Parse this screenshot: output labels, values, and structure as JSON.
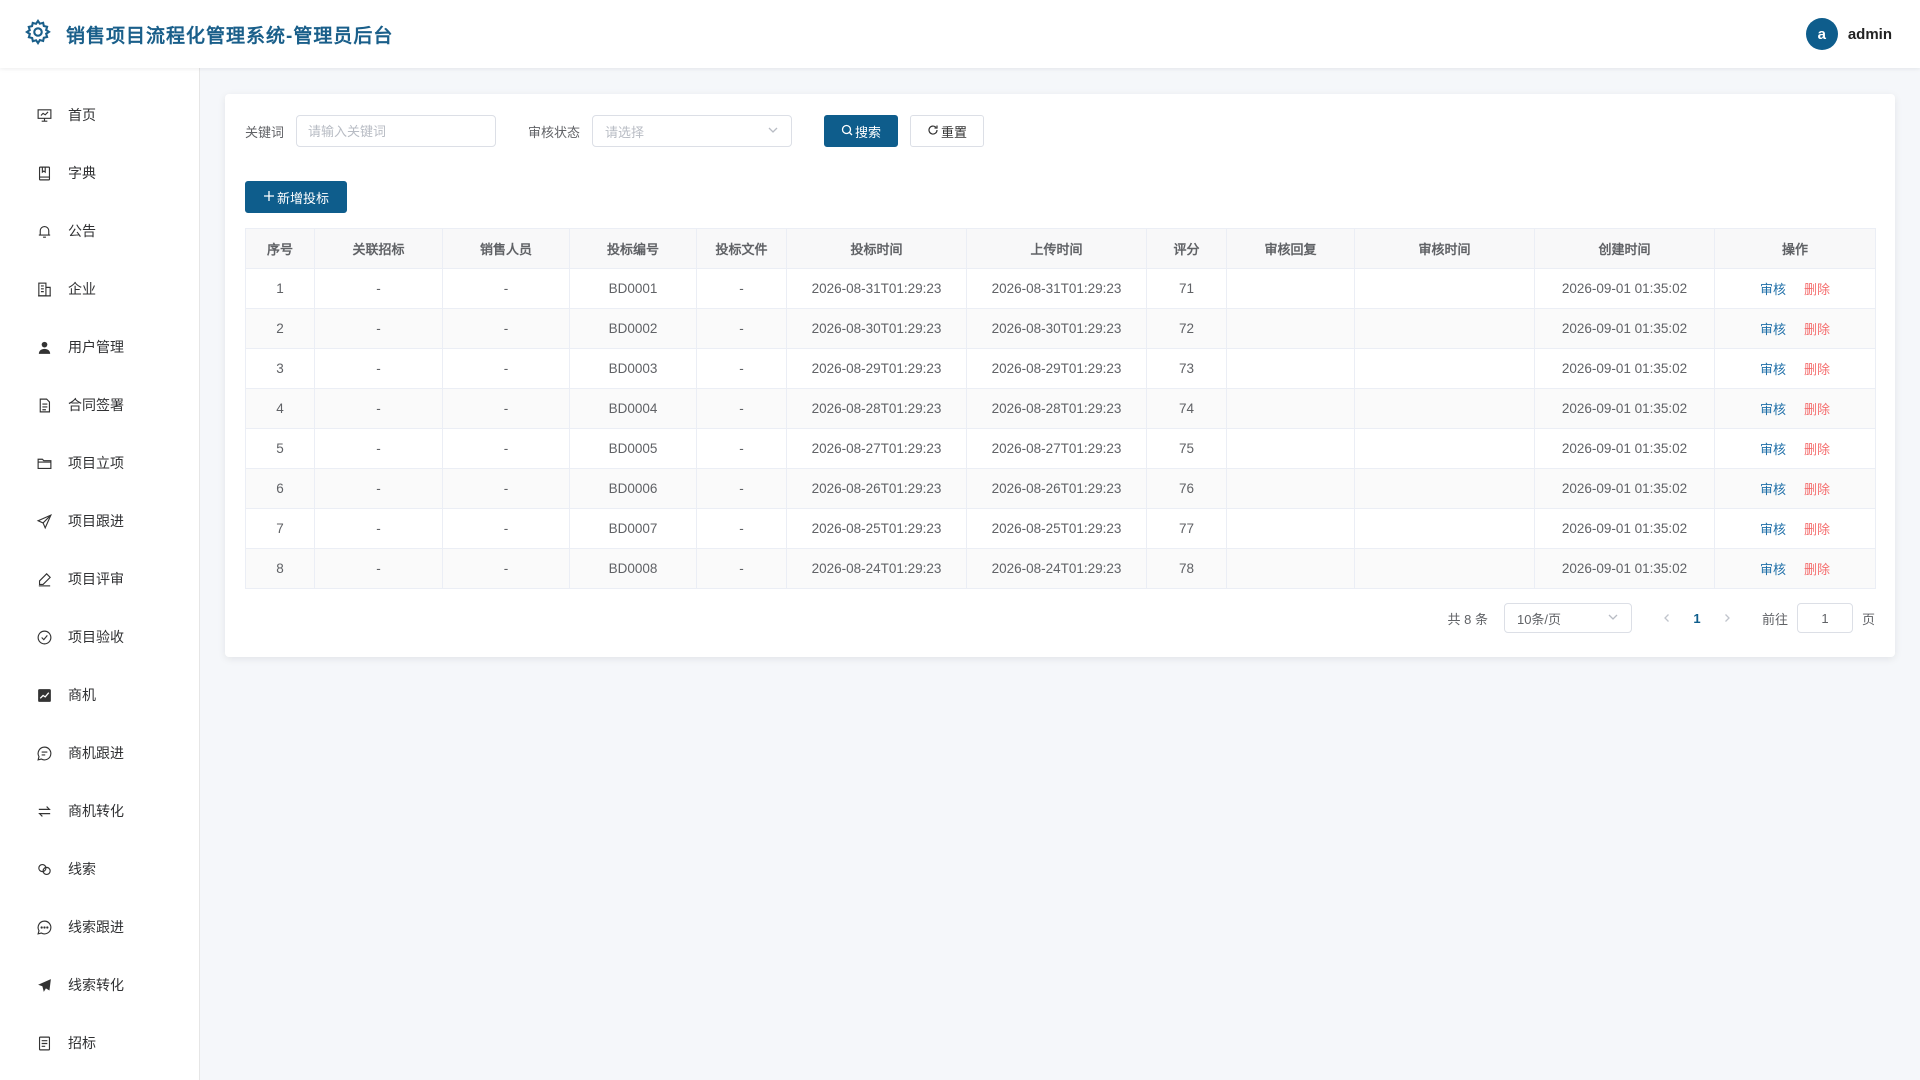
{
  "app": {
    "title": "销售项目流程化管理系统-管理员后台",
    "brand_icon": "gear-icon",
    "accent": "#0e5d8c"
  },
  "user": {
    "avatar_letter": "a",
    "name": "admin"
  },
  "sidebar": {
    "items": [
      {
        "label": "首页",
        "icon": "presentation-icon"
      },
      {
        "label": "字典",
        "icon": "book-icon"
      },
      {
        "label": "公告",
        "icon": "bell-icon"
      },
      {
        "label": "企业",
        "icon": "building-icon"
      },
      {
        "label": "用户管理",
        "icon": "user-icon"
      },
      {
        "label": "合同签署",
        "icon": "document-icon"
      },
      {
        "label": "项目立项",
        "icon": "folder-icon"
      },
      {
        "label": "项目跟进",
        "icon": "send-icon"
      },
      {
        "label": "项目评审",
        "icon": "edit-pen-icon"
      },
      {
        "label": "项目验收",
        "icon": "check-circle-icon"
      },
      {
        "label": "商机",
        "icon": "trend-chart-icon"
      },
      {
        "label": "商机跟进",
        "icon": "chat-icon"
      },
      {
        "label": "商机转化",
        "icon": "switch-icon"
      },
      {
        "label": "线索",
        "icon": "link-icon"
      },
      {
        "label": "线索跟进",
        "icon": "chat-dots-icon"
      },
      {
        "label": "线索转化",
        "icon": "paper-plane-icon"
      },
      {
        "label": "招标",
        "icon": "list-document-icon"
      }
    ]
  },
  "filters": {
    "keyword_label": "关键词",
    "keyword_placeholder": "请输入关键词",
    "keyword_value": "",
    "status_label": "审核状态",
    "status_placeholder": "请选择",
    "search_label": "搜索",
    "reset_label": "重置"
  },
  "toolbar": {
    "add_label": "新增投标"
  },
  "table": {
    "columns": [
      "序号",
      "关联招标",
      "销售人员",
      "投标编号",
      "投标文件",
      "投标时间",
      "上传时间",
      "评分",
      "审核回复",
      "审核时间",
      "创建时间",
      "操作"
    ],
    "rows": [
      [
        "1",
        "-",
        "-",
        "BD0001",
        "-",
        "2026-08-31T01:29:23",
        "2026-08-31T01:29:23",
        "71",
        "",
        "",
        "2026-09-01 01:35:02"
      ],
      [
        "2",
        "-",
        "-",
        "BD0002",
        "-",
        "2026-08-30T01:29:23",
        "2026-08-30T01:29:23",
        "72",
        "",
        "",
        "2026-09-01 01:35:02"
      ],
      [
        "3",
        "-",
        "-",
        "BD0003",
        "-",
        "2026-08-29T01:29:23",
        "2026-08-29T01:29:23",
        "73",
        "",
        "",
        "2026-09-01 01:35:02"
      ],
      [
        "4",
        "-",
        "-",
        "BD0004",
        "-",
        "2026-08-28T01:29:23",
        "2026-08-28T01:29:23",
        "74",
        "",
        "",
        "2026-09-01 01:35:02"
      ],
      [
        "5",
        "-",
        "-",
        "BD0005",
        "-",
        "2026-08-27T01:29:23",
        "2026-08-27T01:29:23",
        "75",
        "",
        "",
        "2026-09-01 01:35:02"
      ],
      [
        "6",
        "-",
        "-",
        "BD0006",
        "-",
        "2026-08-26T01:29:23",
        "2026-08-26T01:29:23",
        "76",
        "",
        "",
        "2026-09-01 01:35:02"
      ],
      [
        "7",
        "-",
        "-",
        "BD0007",
        "-",
        "2026-08-25T01:29:23",
        "2026-08-25T01:29:23",
        "77",
        "",
        "",
        "2026-09-01 01:35:02"
      ],
      [
        "8",
        "-",
        "-",
        "BD0008",
        "-",
        "2026-08-24T01:29:23",
        "2026-08-24T01:29:23",
        "78",
        "",
        "",
        "2026-09-01 01:35:02"
      ]
    ],
    "actions": {
      "audit": "审核",
      "delete": "删除"
    }
  },
  "pagination": {
    "total_text": "共 8 条",
    "page_size": "10条/页",
    "current_page": "1",
    "goto_label": "前往",
    "goto_value": "1",
    "page_suffix": "页"
  }
}
